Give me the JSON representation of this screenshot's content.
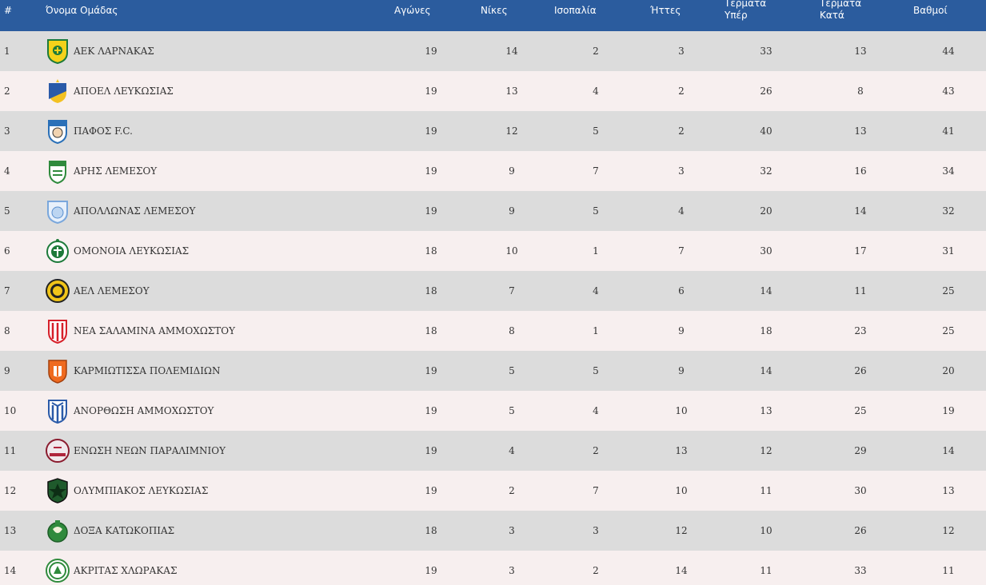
{
  "header": {
    "rank": "#",
    "team": "Όνομα Ομάδας",
    "played": "Αγώνες",
    "wins": "Νίκες",
    "draws": "Ισοπαλία",
    "losses": "Ήττες",
    "gf_line1": "Τέρματα",
    "gf_line2": "Υπέρ",
    "ga_line1": "Τέρματα",
    "ga_line2": "Κατά",
    "points": "Βαθμοί"
  },
  "rows": [
    {
      "rank": "1",
      "team": "ΑΕΚ ΛΑΡΝΑΚΑΣ",
      "logo": "aek-larnaca-crest-icon",
      "played": "19",
      "wins": "14",
      "draws": "2",
      "losses": "3",
      "gf": "33",
      "ga": "13",
      "points": "44"
    },
    {
      "rank": "2",
      "team": "ΑΠΟΕΛ ΛΕΥΚΩΣΙΑΣ",
      "logo": "apoel-crest-icon",
      "played": "19",
      "wins": "13",
      "draws": "4",
      "losses": "2",
      "gf": "26",
      "ga": "8",
      "points": "43"
    },
    {
      "rank": "3",
      "team": "ΠΑΦΟΣ F.C.",
      "logo": "pafos-crest-icon",
      "played": "19",
      "wins": "12",
      "draws": "5",
      "losses": "2",
      "gf": "40",
      "ga": "13",
      "points": "41"
    },
    {
      "rank": "4",
      "team": "ΑΡΗΣ ΛΕΜΕΣΟΥ",
      "logo": "aris-limassol-crest-icon",
      "played": "19",
      "wins": "9",
      "draws": "7",
      "losses": "3",
      "gf": "32",
      "ga": "16",
      "points": "34"
    },
    {
      "rank": "5",
      "team": "ΑΠΟΛΛΩΝΑΣ ΛΕΜΕΣΟΥ",
      "logo": "apollon-crest-icon",
      "played": "19",
      "wins": "9",
      "draws": "5",
      "losses": "4",
      "gf": "20",
      "ga": "14",
      "points": "32"
    },
    {
      "rank": "6",
      "team": "ΟΜΟΝΟΙΑ ΛΕΥΚΩΣΙΑΣ",
      "logo": "omonoia-crest-icon",
      "played": "18",
      "wins": "10",
      "draws": "1",
      "losses": "7",
      "gf": "30",
      "ga": "17",
      "points": "31"
    },
    {
      "rank": "7",
      "team": "ΑΕΛ ΛΕΜΕΣΟΥ",
      "logo": "ael-crest-icon",
      "played": "18",
      "wins": "7",
      "draws": "4",
      "losses": "6",
      "gf": "14",
      "ga": "11",
      "points": "25"
    },
    {
      "rank": "8",
      "team": "ΝΕΑ ΣΑΛΑΜΙΝΑ ΑΜΜΟΧΩΣΤΟΥ",
      "logo": "nea-salamina-crest-icon",
      "played": "18",
      "wins": "8",
      "draws": "1",
      "losses": "9",
      "gf": "18",
      "ga": "23",
      "points": "25"
    },
    {
      "rank": "9",
      "team": "ΚΑΡΜΙΩΤΙΣΣΑ ΠΟΛΕΜΙΔΙΩΝ",
      "logo": "karmiotissa-crest-icon",
      "played": "19",
      "wins": "5",
      "draws": "5",
      "losses": "9",
      "gf": "14",
      "ga": "26",
      "points": "20"
    },
    {
      "rank": "10",
      "team": "ΑΝΟΡΘΩΣΗ ΑΜΜΟΧΩΣΤΟΥ",
      "logo": "anorthosis-crest-icon",
      "played": "19",
      "wins": "5",
      "draws": "4",
      "losses": "10",
      "gf": "13",
      "ga": "25",
      "points": "19"
    },
    {
      "rank": "11",
      "team": "ΕΝΩΣΗ ΝΕΩΝ ΠΑΡΑΛΙΜΝΙΟΥ",
      "logo": "enp-crest-icon",
      "played": "19",
      "wins": "4",
      "draws": "2",
      "losses": "13",
      "gf": "12",
      "ga": "29",
      "points": "14"
    },
    {
      "rank": "12",
      "team": "ΟΛΥΜΠΙΑΚΟΣ ΛΕΥΚΩΣΙΑΣ",
      "logo": "olympiakos-nicosia-crest-icon",
      "played": "19",
      "wins": "2",
      "draws": "7",
      "losses": "10",
      "gf": "11",
      "ga": "30",
      "points": "13"
    },
    {
      "rank": "13",
      "team": "ΔΟΞΑ ΚΑΤΩΚΟΠΙΑΣ",
      "logo": "doxa-crest-icon",
      "played": "18",
      "wins": "3",
      "draws": "3",
      "losses": "12",
      "gf": "10",
      "ga": "26",
      "points": "12"
    },
    {
      "rank": "14",
      "team": "ΑΚΡΙΤΑΣ ΧΛΩΡΑΚΑΣ",
      "logo": "akritas-crest-icon",
      "played": "19",
      "wins": "3",
      "draws": "2",
      "losses": "14",
      "gf": "11",
      "ga": "33",
      "points": "11"
    }
  ],
  "colors": {
    "header_bg": "#2b5c9e",
    "row_odd": "#dcdcdc",
    "row_even": "#f7efef"
  }
}
